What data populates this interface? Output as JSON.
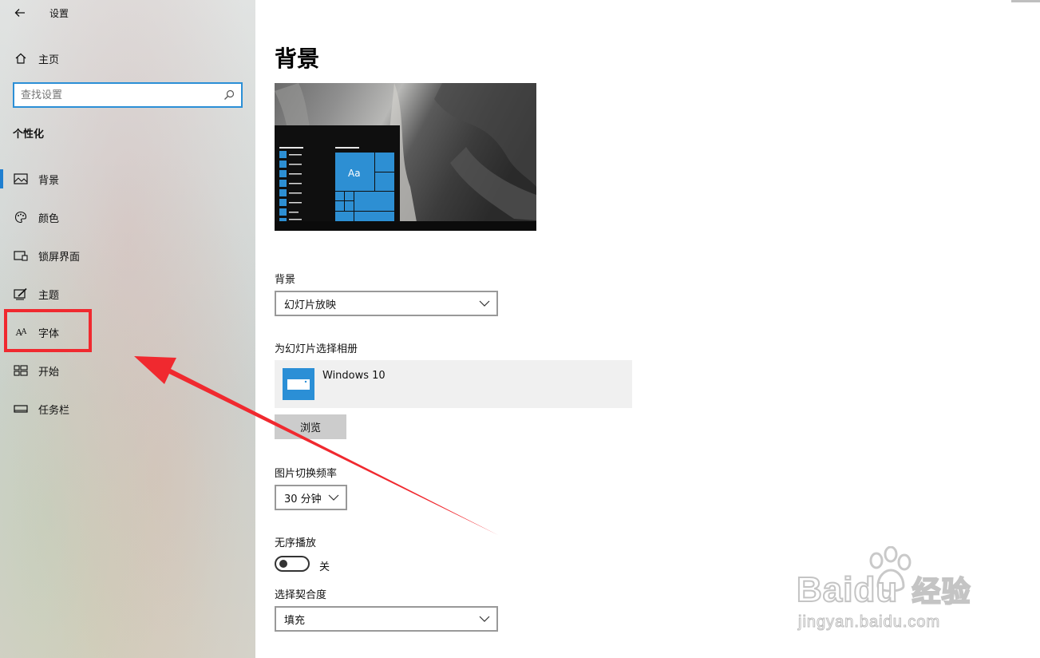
{
  "window": {
    "title": "设置",
    "back_icon": "arrow-left-icon"
  },
  "sidebar": {
    "home_label": "主页",
    "search": {
      "placeholder": "查找设置",
      "value": ""
    },
    "section_title": "个性化",
    "items": [
      {
        "label": "背景",
        "icon": "picture-icon",
        "active": true
      },
      {
        "label": "颜色",
        "icon": "palette-icon"
      },
      {
        "label": "锁屏界面",
        "icon": "lock-screen-icon"
      },
      {
        "label": "主题",
        "icon": "theme-icon"
      },
      {
        "label": "字体",
        "icon": "font-icon"
      },
      {
        "label": "开始",
        "icon": "start-icon"
      },
      {
        "label": "任务栏",
        "icon": "taskbar-icon"
      }
    ],
    "accent": "#1f7fd0"
  },
  "main": {
    "title": "背景",
    "preview": {
      "tile_text": "Aa"
    },
    "background": {
      "label": "背景",
      "selected": "幻灯片放映"
    },
    "album": {
      "label": "为幻灯片选择相册",
      "name": "Windows 10",
      "browse_label": "浏览"
    },
    "interval": {
      "label": "图片切换频率",
      "selected": "30 分钟"
    },
    "shuffle": {
      "label": "无序播放",
      "state_text": "关",
      "on": false
    },
    "fit": {
      "label": "选择契合度",
      "selected": "填充"
    }
  },
  "annotation": {
    "highlight_color": "#f0292f",
    "target": "字体"
  },
  "watermark": {
    "brand": "Bai",
    "brand_suffix": "du",
    "product": "经验",
    "url": "jingyan.baidu.com"
  }
}
